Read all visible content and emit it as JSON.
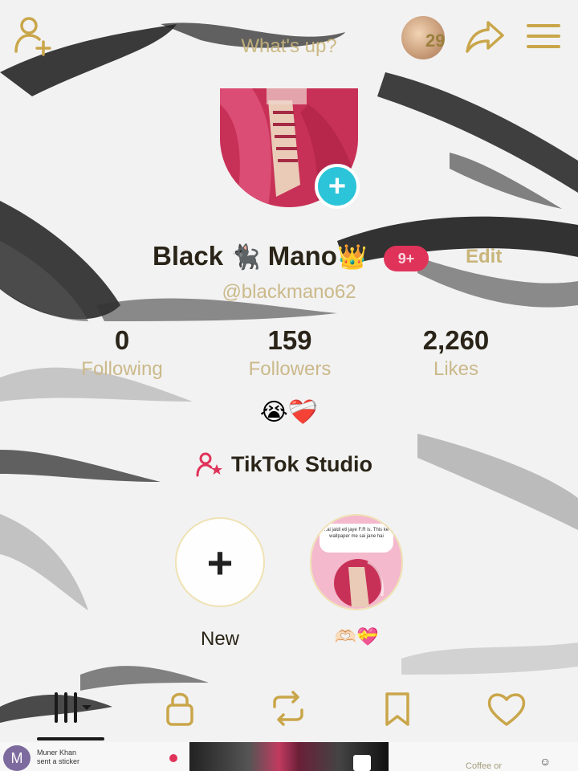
{
  "header": {
    "add_friend_icon": "person-plus-icon",
    "status_prompt": "What's up?",
    "notification_count": "29",
    "share_icon": "share-arrow-icon",
    "menu_icon": "hamburger-menu-icon"
  },
  "profile": {
    "name_part1": "Black",
    "name_emoji1": "🐈‍⬛",
    "name_part2": "Mano",
    "name_emoji2": "👑",
    "level_badge": "9+",
    "edit_label": "Edit",
    "username": "@blackmano62",
    "bio": "😭❤️‍🩹"
  },
  "stats": {
    "following": {
      "value": "0",
      "label": "Following"
    },
    "followers": {
      "value": "159",
      "label": "Followers"
    },
    "likes": {
      "value": "2,260",
      "label": "Likes"
    }
  },
  "studio": {
    "label": "TikTok Studio",
    "icon": "person-star-icon"
  },
  "highlights": {
    "new_label": "New",
    "new_icon": "plus-icon",
    "item_label": "🫶🏻💝",
    "item_bubble": "..ai jaldi etl jaye F.R is. This ke wallpaper me sai jane hai"
  },
  "tabs": [
    {
      "icon": "grid-icon"
    },
    {
      "icon": "lock-icon"
    },
    {
      "icon": "repost-icon"
    },
    {
      "icon": "bookmark-icon"
    },
    {
      "icon": "heart-icon"
    }
  ],
  "bottom_strip": {
    "avatar_letter": "M",
    "sender": "Muner Khan",
    "message": "sent a sticker",
    "caption": "Coffee or"
  },
  "colors": {
    "accent_gold": "#c9b57a",
    "badge_pink": "#e0335a",
    "plus_teal": "#2cc4d8",
    "text_dark": "#2a2418"
  }
}
